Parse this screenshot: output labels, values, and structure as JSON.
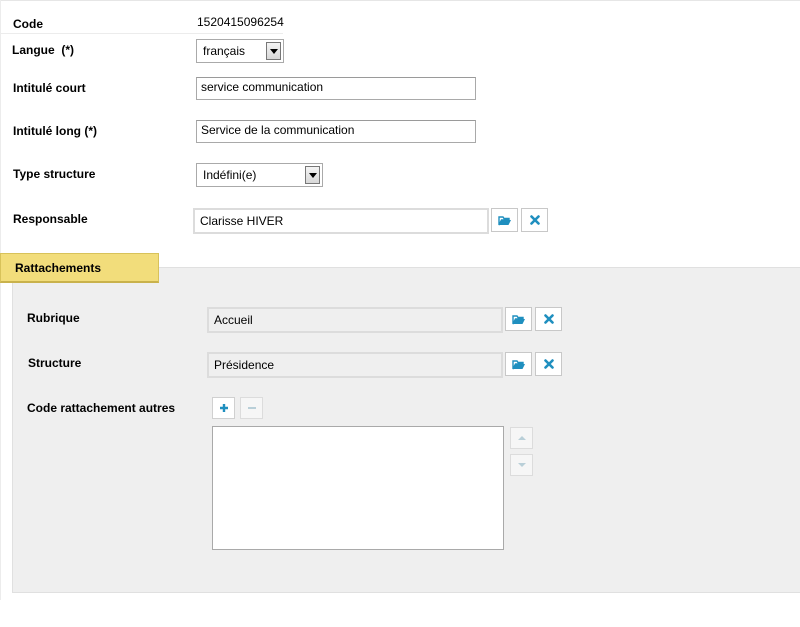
{
  "form": {
    "code": {
      "label": "Code",
      "value": "1520415096254"
    },
    "langue": {
      "label": "Langue  (*)",
      "selected": "français"
    },
    "intitule_court": {
      "label": "Intitulé court",
      "value": "service communication"
    },
    "intitule_long": {
      "label": "Intitulé long (*)",
      "value": "Service de la communication"
    },
    "type_structure": {
      "label": "Type structure",
      "selected": "Indéfini(e)"
    },
    "responsable": {
      "label": "Responsable",
      "value": "Clarisse HIVER"
    }
  },
  "rattachements": {
    "tab_label": "Rattachements",
    "rubrique": {
      "label": "Rubrique",
      "value": "Accueil"
    },
    "structure": {
      "label": "Structure",
      "value": "Présidence"
    },
    "code_rattachement": {
      "label": "Code rattachement autres",
      "items": []
    }
  },
  "colors": {
    "icon_blue": "#1f8fbf",
    "tab_bg": "#f2dd7b",
    "panel_bg": "#efefef"
  },
  "icons": {
    "browse": "folder-open-icon",
    "clear": "close-icon",
    "add": "plus-icon",
    "remove": "minus-icon",
    "up": "arrow-up-icon",
    "down": "arrow-down-icon"
  }
}
